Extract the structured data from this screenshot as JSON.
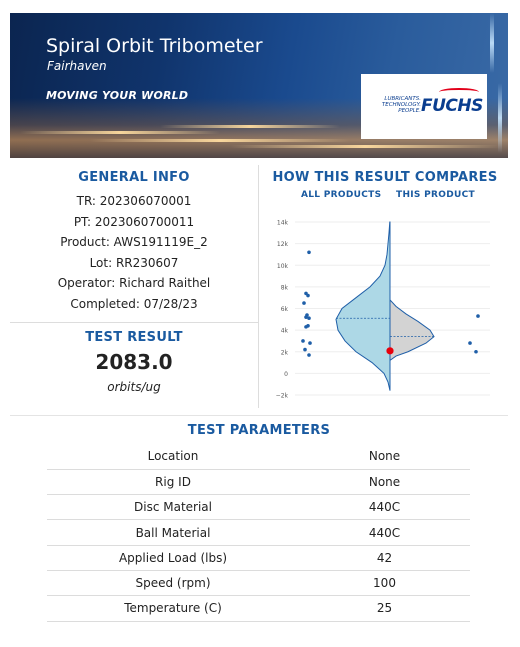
{
  "header": {
    "title": "Spiral Orbit Tribometer",
    "subtitle": "Fairhaven",
    "slogan": "MOVING YOUR WORLD",
    "logo_tagline": "LUBRICANTS. TECHNOLOGY. PEOPLE.",
    "logo_word": "FUCHS"
  },
  "general_info": {
    "title": "GENERAL INFO",
    "rows": [
      "TR: 202306070001",
      "PT: 2023060700011",
      "Product: AWS191119E_2",
      "Lot: RR230607",
      "Operator: Richard Raithel",
      "Completed: 07/28/23"
    ]
  },
  "test_result": {
    "title": "TEST RESULT",
    "value": "2083.0",
    "unit": "orbits/ug"
  },
  "comparison": {
    "title": "HOW THIS RESULT COMPARES",
    "legend_all": "ALL PRODUCTS",
    "legend_this": "THIS PRODUCT"
  },
  "chart_data": {
    "type": "violin",
    "y_ticks": [
      "14k",
      "12k",
      "10k",
      "8k",
      "6k",
      "4k",
      "2k",
      "0",
      "−2k"
    ],
    "ylim": [
      -2000,
      14500
    ],
    "this_result": 2083,
    "all_products_points": [
      11200,
      7400,
      7200,
      6500,
      5400,
      5200,
      5100,
      4400,
      4300,
      3000,
      2800,
      2200,
      1700
    ],
    "this_product_points": [
      5300,
      2800,
      2000
    ],
    "all_products_mean": 5100,
    "this_product_mean": 3400,
    "colors": {
      "all_fill": "#add8e6",
      "this_fill": "#d3d3d3",
      "outline": "#1f5fa8",
      "point": "#1f5fa8",
      "result": "#e8000b"
    }
  },
  "parameters": {
    "title": "TEST PARAMETERS",
    "rows": [
      {
        "label": "Location",
        "value": "None"
      },
      {
        "label": "Rig ID",
        "value": "None"
      },
      {
        "label": "Disc Material",
        "value": "440C"
      },
      {
        "label": "Ball Material",
        "value": "440C"
      },
      {
        "label": "Applied Load (lbs)",
        "value": "42"
      },
      {
        "label": "Speed (rpm)",
        "value": "100"
      },
      {
        "label": "Temperature (C)",
        "value": "25"
      }
    ]
  }
}
